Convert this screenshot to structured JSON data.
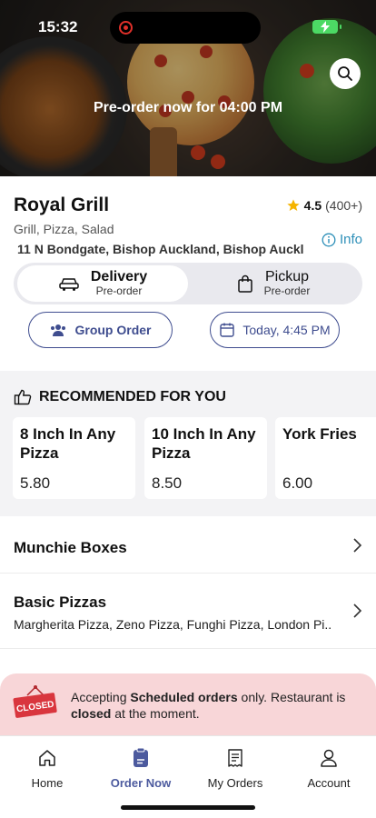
{
  "status_bar": {
    "time": "15:32"
  },
  "hero": {
    "banner_text": "Pre-order now for 04:00 PM",
    "search_icon": "search-icon"
  },
  "restaurant": {
    "name": "Royal Grill",
    "rating": "4.5",
    "rating_count": "(400+)",
    "cuisine": "Grill, Pizza, Salad",
    "address": "11 N Bondgate, Bishop Auckland, Bishop Auckla...",
    "info_label": "Info"
  },
  "order_mode": {
    "delivery": {
      "label": "Delivery",
      "sub": "Pre-order",
      "icon": "car-icon",
      "selected": true
    },
    "pickup": {
      "label": "Pickup",
      "sub": "Pre-order",
      "icon": "bag-icon",
      "selected": false
    }
  },
  "actions": {
    "group_order": "Group Order",
    "date": "Today, 4:45 PM"
  },
  "recommended": {
    "title": "RECOMMENDED FOR YOU",
    "items": [
      {
        "name": "8 Inch In Any Pizza",
        "price": "5.80"
      },
      {
        "name": "10 Inch In Any Pizza",
        "price": "8.50"
      },
      {
        "name": "York Fries",
        "price": "6.00"
      }
    ]
  },
  "categories": [
    {
      "title": "Munchie Boxes",
      "desc": ""
    },
    {
      "title": "Basic Pizzas",
      "desc": "Margherita Pizza, Zeno Pizza, Funghi Pizza, London Pi..."
    }
  ],
  "closed_banner": {
    "sign": "CLOSED",
    "text_1": "Accepting ",
    "bold_1": "Scheduled orders",
    "text_2": " only. Restaurant is ",
    "bold_2": "closed",
    "text_3": " at the moment."
  },
  "tabs": [
    {
      "label": "Home",
      "icon": "home-icon",
      "active": false
    },
    {
      "label": "Order Now",
      "icon": "order-icon",
      "active": true
    },
    {
      "label": "My Orders",
      "icon": "receipt-icon",
      "active": false
    },
    {
      "label": "Account",
      "icon": "account-icon",
      "active": false
    }
  ],
  "colors": {
    "accent": "#4c5a9e",
    "info": "#2d8fb8",
    "star": "#f5b400",
    "closed_bg": "#f8d6d8",
    "closed_sign": "#d9363e"
  }
}
